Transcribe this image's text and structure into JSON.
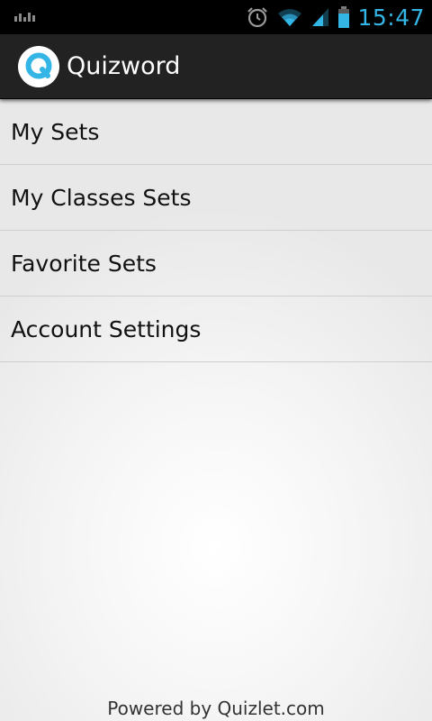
{
  "status_bar": {
    "time": "15:47",
    "icons": [
      "signal-bars-icon",
      "alarm-icon",
      "wifi-icon",
      "cell-signal-icon",
      "battery-icon"
    ],
    "accent_color": "#33b5e5"
  },
  "action_bar": {
    "title": "Quizword",
    "logo_letter": "Q",
    "logo_color": "#33b5e5"
  },
  "menu": {
    "items": [
      {
        "label": "My Sets"
      },
      {
        "label": "My Classes Sets"
      },
      {
        "label": "Favorite Sets"
      },
      {
        "label": "Account Settings"
      }
    ]
  },
  "footer": {
    "text": "Powered by Quizlet.com"
  }
}
